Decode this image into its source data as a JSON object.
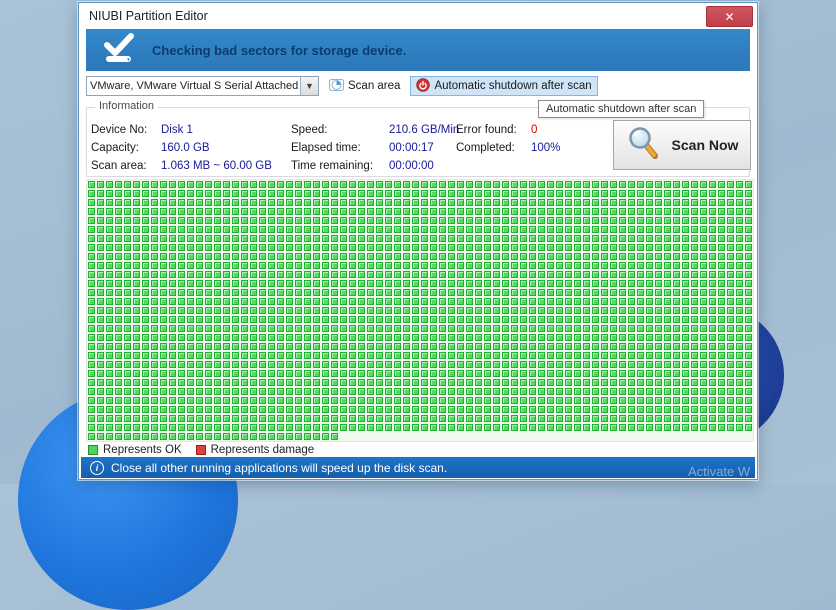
{
  "window": {
    "title": "NIUBI Partition Editor",
    "close_glyph": "✕"
  },
  "banner": {
    "text": "Checking bad sectors for storage device."
  },
  "toolbar": {
    "device_selected": "VMware, VMware Virtual S Serial Attached SCSI (",
    "combo_arrow_glyph": "▼",
    "scan_area_label": "Scan area",
    "auto_shutdown_label": "Automatic shutdown after scan"
  },
  "tooltip": {
    "text": "Automatic shutdown after scan"
  },
  "information": {
    "group_label": "Information",
    "col1": [
      {
        "label": "Device No:",
        "value": "Disk 1"
      },
      {
        "label": "Capacity:",
        "value": "160.0 GB"
      },
      {
        "label": "Scan area:",
        "value": "1.063 MB ~ 60.00 GB"
      }
    ],
    "col2": [
      {
        "label": "Speed:",
        "value": "210.6 GB/Min"
      },
      {
        "label": "Elapsed time:",
        "value": "00:00:17"
      },
      {
        "label": "Time remaining:",
        "value": "00:00:00"
      }
    ],
    "col3": [
      {
        "label": "Error found:",
        "value": "0"
      },
      {
        "label": "Completed:",
        "value": "100%"
      }
    ]
  },
  "scan_button": {
    "label": "Scan Now"
  },
  "grid": {
    "columns": 74,
    "full_rows": 28,
    "partial_row_cells": 28,
    "ok_color": "#52dc5e",
    "damage_color": "#e04040"
  },
  "legend": {
    "ok_label": "Represents OK",
    "damage_label": "Represents damage"
  },
  "status_bar": {
    "text": "Close all other running applications will speed up the disk scan.",
    "info_glyph": "i"
  },
  "watermark": {
    "text": "Activate W"
  },
  "colors": {
    "banner_blue": "#2e80c4",
    "status_blue": "#1566bd",
    "close_red": "#c9414d",
    "value_navy": "#181899",
    "error_red": "#e00000",
    "sector_ok_green": "#52dc5e",
    "desktop_blue": "#a3bdd2"
  }
}
